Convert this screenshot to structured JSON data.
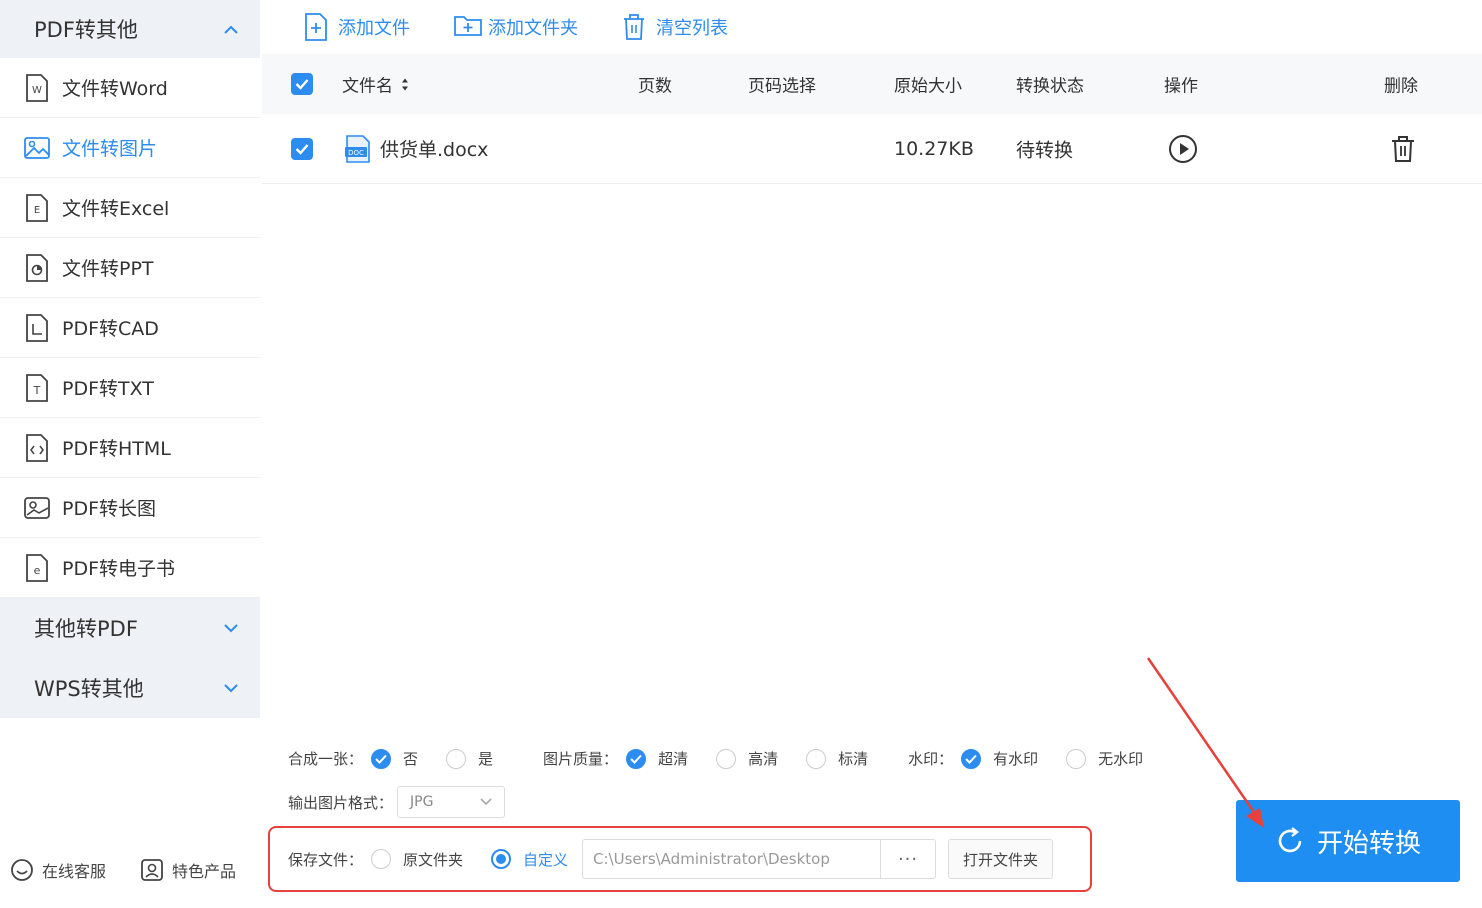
{
  "sidebar": {
    "group_pdf_to_other": "PDF转其他",
    "items": [
      {
        "label": "文件转Word",
        "icon": "word-file-icon"
      },
      {
        "label": "文件转图片",
        "icon": "image-file-icon"
      },
      {
        "label": "文件转Excel",
        "icon": "excel-file-icon"
      },
      {
        "label": "文件转PPT",
        "icon": "ppt-file-icon"
      },
      {
        "label": "PDF转CAD",
        "icon": "cad-file-icon"
      },
      {
        "label": "PDF转TXT",
        "icon": "txt-file-icon"
      },
      {
        "label": "PDF转HTML",
        "icon": "html-file-icon"
      },
      {
        "label": "PDF转长图",
        "icon": "long-image-icon"
      },
      {
        "label": "PDF转电子书",
        "icon": "ebook-file-icon"
      }
    ],
    "group_other_to_pdf": "其他转PDF",
    "group_wps_to_other": "WPS转其他",
    "online_service": "在线客服",
    "featured_products": "特色产品"
  },
  "toolbar": {
    "add_file": "添加文件",
    "add_folder": "添加文件夹",
    "clear_list": "清空列表"
  },
  "table": {
    "headers": {
      "filename": "文件名",
      "pages": "页数",
      "page_select": "页码选择",
      "original_size": "原始大小",
      "status": "转换状态",
      "action": "操作",
      "delete": "删除"
    },
    "rows": [
      {
        "filename": "供货单.docx",
        "pages": "",
        "page_select": "",
        "size": "10.27KB",
        "status": "待转换"
      }
    ]
  },
  "options": {
    "merge_label": "合成一张：",
    "merge_no": "否",
    "merge_yes": "是",
    "quality_label": "图片质量：",
    "quality_ultra": "超清",
    "quality_high": "高清",
    "quality_standard": "标清",
    "watermark_label": "水印：",
    "watermark_yes": "有水印",
    "watermark_no": "无水印",
    "format_label": "输出图片格式：",
    "format_value": "JPG",
    "save_label": "保存文件：",
    "save_original": "原文件夹",
    "save_custom": "自定义",
    "save_path": "C:\\Users\\Administrator\\Desktop",
    "browse": "···",
    "open_folder": "打开文件夹"
  },
  "start_button": "开始转换",
  "colors": {
    "accent": "#2d8cf0",
    "highlight": "#e8403a"
  }
}
